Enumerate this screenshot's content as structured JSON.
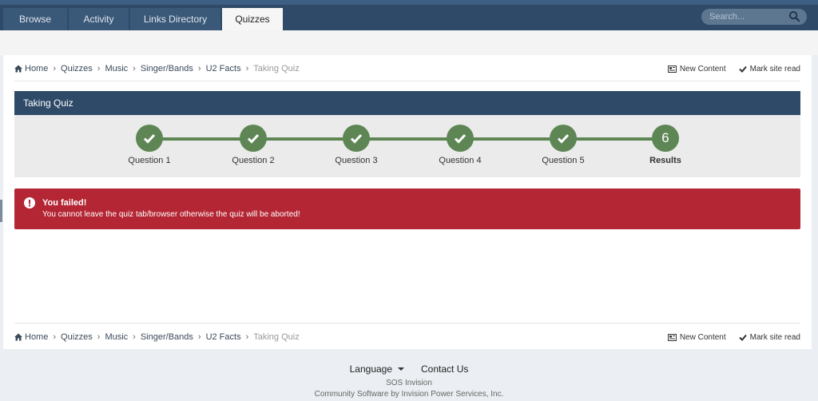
{
  "nav": {
    "tabs": [
      {
        "label": "Browse"
      },
      {
        "label": "Activity"
      },
      {
        "label": "Links Directory"
      },
      {
        "label": "Quizzes"
      }
    ],
    "active_tab": "Quizzes",
    "search_placeholder": "Search..."
  },
  "breadcrumb": {
    "items": [
      "Home",
      "Quizzes",
      "Music",
      "Singer/Bands",
      "U2 Facts"
    ],
    "current": "Taking Quiz"
  },
  "links": {
    "new_content": "New Content",
    "mark_read": "Mark site read"
  },
  "panel": {
    "title": "Taking Quiz",
    "steps": [
      {
        "label": "Question 1",
        "done": true
      },
      {
        "label": "Question 2",
        "done": true
      },
      {
        "label": "Question 3",
        "done": true
      },
      {
        "label": "Question 4",
        "done": true
      },
      {
        "label": "Question 5",
        "done": true
      },
      {
        "label": "Results",
        "number": "6",
        "done": false
      }
    ]
  },
  "alert": {
    "title": "You failed!",
    "message": "You cannot leave the quiz tab/browser otherwise the quiz will be aborted!"
  },
  "footer": {
    "language": "Language",
    "contact": "Contact Us",
    "site_name": "SOS Invision",
    "copyright": "Community Software by Invision Power Services, Inc."
  },
  "colors": {
    "nav_bg": "#2e4a68",
    "step_green": "#5e8655",
    "alert_red": "#b42634"
  }
}
